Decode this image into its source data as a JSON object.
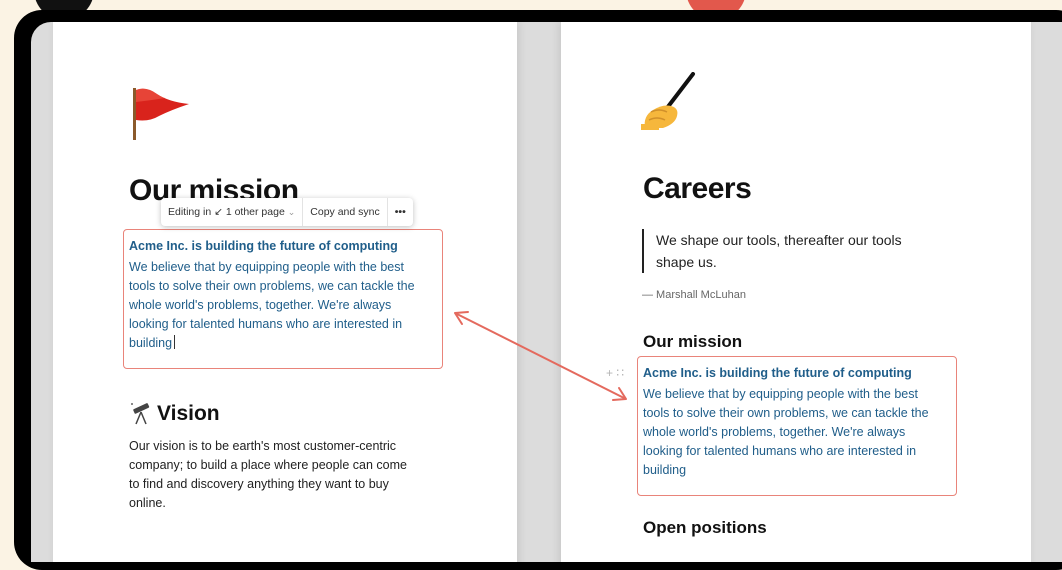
{
  "left_page": {
    "icon": "red-flag-icon",
    "title": "Our mission",
    "toolbar": {
      "editing": "Editing in ↙ 1 other page",
      "copy_sync": "Copy and sync",
      "more": "•••"
    },
    "synced_block": {
      "heading": "Acme Inc. is building the future of computing",
      "lines": [
        "We believe that by equipping people with the best",
        "tools to solve their own problems, we can tackle the",
        "whole world's problems, together. We're always",
        "looking for talented humans who are interested in",
        "building"
      ]
    },
    "vision": {
      "icon": "telescope-icon",
      "title": "Vision",
      "lines": [
        "Our vision is to be earth's most customer-centric",
        "company; to build a place where people can come",
        "to find and discovery anything they want to buy",
        "online."
      ]
    }
  },
  "right_page": {
    "icon": "writing-hand-icon",
    "title": "Careers",
    "quote": {
      "lines": [
        "We shape our tools, thereafter our tools",
        "shape us."
      ],
      "attribution": "— Marshall McLuhan"
    },
    "mission_heading": "Our mission",
    "block_handle": "+ ∷",
    "synced_block": {
      "heading": "Acme Inc. is building the future of computing",
      "lines": [
        "We believe that by equipping people with the best",
        "tools to solve their own problems, we can tackle the",
        "whole world's problems, together. We're always",
        "looking for talented humans who are interested in",
        "building"
      ]
    },
    "open_positions": "Open positions"
  },
  "colors": {
    "background": "#fbf3e4",
    "frame": "#000000",
    "synced_border": "#e9847a",
    "synced_text": "#205e8a",
    "arrow": "#e46a5e"
  }
}
